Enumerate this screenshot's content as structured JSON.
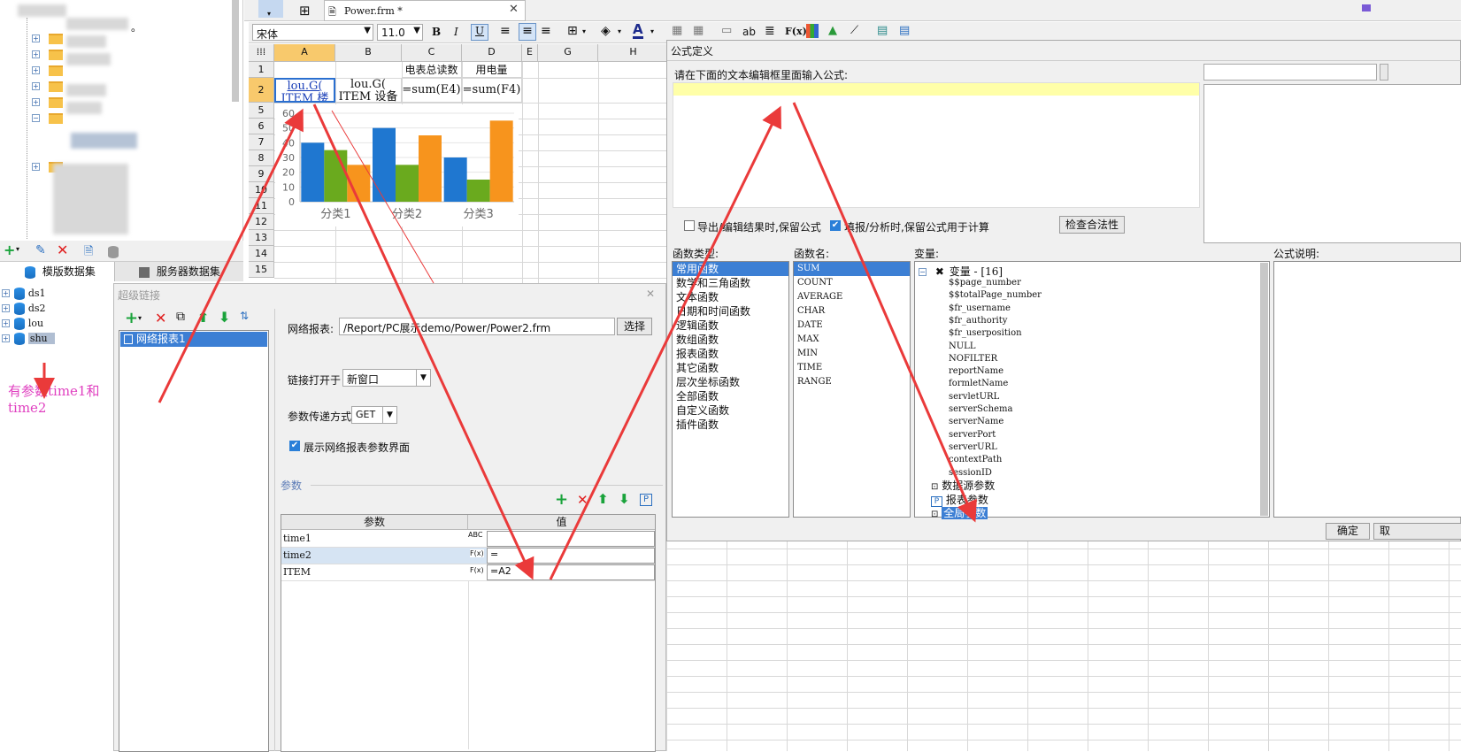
{
  "top_tab": {
    "file_name": "Power.frm *"
  },
  "font_toolbar": {
    "font_name": "宋体",
    "font_size": "11.0",
    "bold": "B",
    "italic": "I",
    "underline": "U",
    "formula_btn": "F(x)",
    "ab_btn": "ab"
  },
  "left_tree": {
    "dot_text": "。"
  },
  "dataset_tabs": {
    "template": "模版数据集",
    "server": "服务器数据集"
  },
  "datasets": [
    "ds1",
    "ds2",
    "lou",
    "shu"
  ],
  "annotation": {
    "text": "有参数time1和time2"
  },
  "sheet": {
    "columns": [
      "A",
      "B",
      "C",
      "D",
      "E",
      "G",
      "H"
    ],
    "rows": [
      "1",
      "2",
      "5",
      "6",
      "7",
      "8",
      "9",
      "10",
      "11",
      "12",
      "13",
      "14",
      "15"
    ],
    "c1": "电表总读数",
    "d1": "用电量",
    "a2": "lou.G( ITEM 楼宇",
    "b2": "lou.G( ITEM 设备",
    "c2": "=sum(E4)",
    "d2": "=sum(F4)"
  },
  "chart_data": {
    "type": "bar",
    "categories": [
      "分类1",
      "分类2",
      "分类3"
    ],
    "series": [
      {
        "values": [
          40,
          50,
          30
        ],
        "color": "#1f77d0"
      },
      {
        "values": [
          35,
          25,
          15
        ],
        "color": "#6aaa1e"
      },
      {
        "values": [
          25,
          45,
          55
        ],
        "color": "#f7941d"
      }
    ],
    "ylim": [
      0,
      60
    ],
    "yticks": [
      "0",
      "10",
      "20",
      "30",
      "40",
      "50",
      "60"
    ]
  },
  "hyperlink_dialog": {
    "title": "超级链接",
    "list_item": "网络报表1",
    "report_label": "网络报表:",
    "report_path": "/Report/PC展示demo/Power/Power2.frm",
    "choose_btn": "选择",
    "open_label": "链接打开于",
    "open_value": "新窗口",
    "method_label": "参数传递方式",
    "method_value": "GET",
    "show_param_label": "展示网络报表参数界面",
    "params_section": "参数",
    "param_col": "参数",
    "value_col": "值",
    "params": [
      {
        "name": "time1",
        "type": "ABC",
        "value": ""
      },
      {
        "name": "time2",
        "type": "F(x)",
        "value": "="
      },
      {
        "name": "ITEM",
        "type": "F(x)",
        "value": "=A2"
      }
    ]
  },
  "formula_dialog": {
    "title": "公式定义",
    "prompt": "请在下面的文本编辑框里面输入公式:",
    "export_keep": "导出/编辑结果时,保留公式",
    "fill_keep": "填报/分析时,保留公式用于计算",
    "check_btn": "检查合法性",
    "func_type_label": "函数类型:",
    "func_name_label": "函数名:",
    "var_label": "变量:",
    "desc_label": "公式说明:",
    "func_types": [
      "常用函数",
      "数学和三角函数",
      "文本函数",
      "日期和时间函数",
      "逻辑函数",
      "数组函数",
      "报表函数",
      "其它函数",
      "层次坐标函数",
      "全部函数",
      "自定义函数",
      "插件函数"
    ],
    "func_names": [
      "SUM",
      "COUNT",
      "AVERAGE",
      "CHAR",
      "DATE",
      "MAX",
      "MIN",
      "TIME",
      "RANGE"
    ],
    "var_root": "变量 - [16]",
    "vars": [
      "$$page_number",
      "$$totalPage_number",
      "$fr_username",
      "$fr_authority",
      "$fr_userposition",
      "NULL",
      "NOFILTER",
      "reportName",
      "formletName",
      "servletURL",
      "serverSchema",
      "serverName",
      "serverPort",
      "serverURL",
      "contextPath",
      "sessionID"
    ],
    "ds_params": "数据源参数",
    "report_params": "报表参数",
    "global_params": "全局参数",
    "ok_btn": "确定",
    "cancel_btn": "取"
  }
}
